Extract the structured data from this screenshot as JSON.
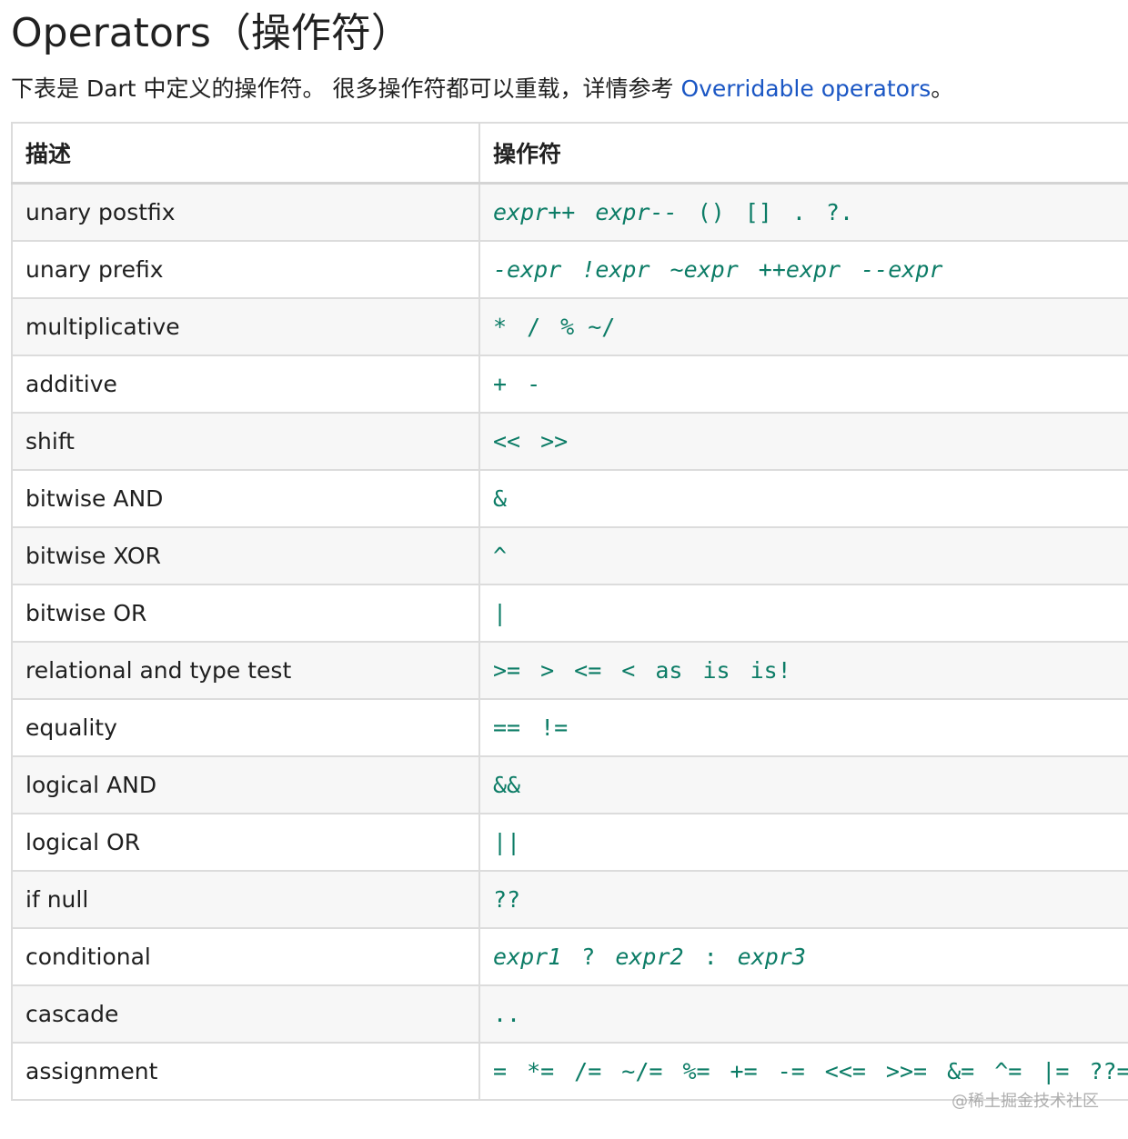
{
  "heading": "Operators（操作符）",
  "intro": {
    "text_before": "下表是 Dart 中定义的操作符。 很多操作符都可以重载，详情参考 ",
    "link_text": "Overridable operators",
    "text_after": "。"
  },
  "table": {
    "headers": [
      "描述",
      "操作符"
    ],
    "rows": [
      {
        "desc": "unary postfix",
        "ops": [
          {
            "t": "expr++",
            "i": true
          },
          {
            "t": "expr--",
            "i": true
          },
          {
            "t": "()",
            "i": false
          },
          {
            "t": "[]",
            "i": false
          },
          {
            "t": ".",
            "i": false
          },
          {
            "t": "?.",
            "i": false
          }
        ]
      },
      {
        "desc": "unary prefix",
        "ops": [
          {
            "t": "-expr",
            "i": true
          },
          {
            "t": "!expr",
            "i": true
          },
          {
            "t": "~expr",
            "i": true
          },
          {
            "t": "++expr",
            "i": true
          },
          {
            "t": "--expr",
            "i": true
          }
        ]
      },
      {
        "desc": "multiplicative",
        "ops": [
          {
            "t": "*",
            "i": false
          },
          {
            "t": "/",
            "i": false
          },
          {
            "t": "% ~/",
            "i": false
          }
        ]
      },
      {
        "desc": "additive",
        "ops": [
          {
            "t": "+",
            "i": false
          },
          {
            "t": "-",
            "i": false
          }
        ]
      },
      {
        "desc": "shift",
        "ops": [
          {
            "t": "<<",
            "i": false
          },
          {
            "t": ">>",
            "i": false
          }
        ]
      },
      {
        "desc": "bitwise AND",
        "ops": [
          {
            "t": "&",
            "i": false
          }
        ]
      },
      {
        "desc": "bitwise XOR",
        "ops": [
          {
            "t": "^",
            "i": false
          }
        ]
      },
      {
        "desc": "bitwise OR",
        "ops": [
          {
            "t": "|",
            "i": false
          }
        ]
      },
      {
        "desc": "relational and type test",
        "ops": [
          {
            "t": ">=",
            "i": false
          },
          {
            "t": ">",
            "i": false
          },
          {
            "t": "<=",
            "i": false
          },
          {
            "t": "<",
            "i": false
          },
          {
            "t": "as",
            "i": false
          },
          {
            "t": "is",
            "i": false
          },
          {
            "t": "is!",
            "i": false
          }
        ]
      },
      {
        "desc": "equality",
        "ops": [
          {
            "t": "==",
            "i": false
          },
          {
            "t": "!=",
            "i": false
          }
        ]
      },
      {
        "desc": "logical AND",
        "ops": [
          {
            "t": "&&",
            "i": false
          }
        ]
      },
      {
        "desc": "logical OR",
        "ops": [
          {
            "t": "||",
            "i": false
          }
        ]
      },
      {
        "desc": "if null",
        "ops": [
          {
            "t": "??",
            "i": false
          }
        ]
      },
      {
        "desc": "conditional",
        "ops": [
          {
            "t": "expr1",
            "i": true
          },
          {
            "t": "?",
            "i": false
          },
          {
            "t": "expr2",
            "i": true
          },
          {
            "t": ":",
            "i": false
          },
          {
            "t": "expr3",
            "i": true
          }
        ]
      },
      {
        "desc": "cascade",
        "ops": [
          {
            "t": "..",
            "i": false
          }
        ]
      },
      {
        "desc": "assignment",
        "ops": [
          {
            "t": "=",
            "i": false
          },
          {
            "t": "*=",
            "i": false
          },
          {
            "t": "/=",
            "i": false
          },
          {
            "t": "~/=",
            "i": false
          },
          {
            "t": "%=",
            "i": false
          },
          {
            "t": "+=",
            "i": false
          },
          {
            "t": "-=",
            "i": false
          },
          {
            "t": "<<=",
            "i": false
          },
          {
            "t": ">>=",
            "i": false
          },
          {
            "t": "&=",
            "i": false
          },
          {
            "t": "^=",
            "i": false
          },
          {
            "t": "|=",
            "i": false
          },
          {
            "t": "??=",
            "i": false
          }
        ]
      }
    ]
  },
  "watermark": "@稀土掘金技术社区",
  "colors": {
    "operator_text": "#0c7c66",
    "link": "#1a56c4",
    "row_stripe": "#f7f7f7",
    "border": "#dcdcdc"
  }
}
